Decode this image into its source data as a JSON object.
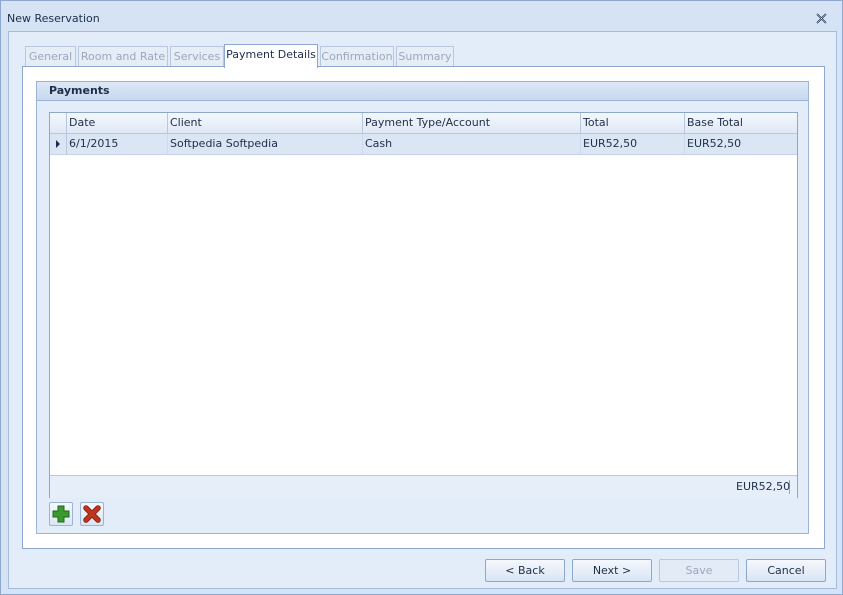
{
  "window": {
    "title": "New Reservation"
  },
  "tabs": [
    {
      "label": "General"
    },
    {
      "label": "Room and Rate"
    },
    {
      "label": "Services"
    },
    {
      "label": "Payment Details"
    },
    {
      "label": "Confirmation"
    },
    {
      "label": "Summary"
    }
  ],
  "active_tab": "Payment Details",
  "payments": {
    "title": "Payments",
    "columns": [
      "Date",
      "Client",
      "Payment Type/Account",
      "Total",
      "Base Total"
    ],
    "rows": [
      [
        "6/1/2015",
        "Softpedia Softpedia",
        "Cash",
        "EUR52,50",
        "EUR52,50"
      ]
    ],
    "footer_total": "EUR52,50"
  },
  "buttons": {
    "back": "< Back",
    "next": "Next >",
    "save": "Save",
    "cancel": "Cancel"
  },
  "colors": {
    "add": "#3a9a2f",
    "delete": "#c0341d"
  },
  "icons": {
    "add": "add-icon",
    "delete": "delete-icon",
    "close": "close-icon"
  }
}
